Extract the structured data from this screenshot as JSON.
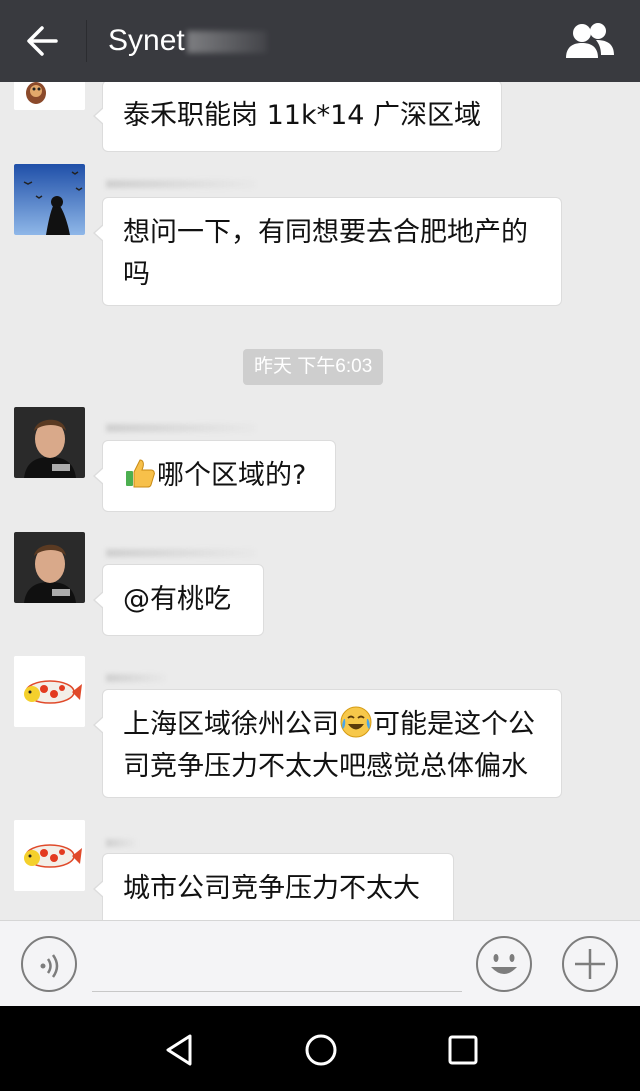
{
  "header": {
    "title": "Synet",
    "back_icon": "arrow-left-icon",
    "group_icon": "group-people-icon"
  },
  "messages": [
    {
      "text": "泰禾职能岗 11k*14 广深区域",
      "avatar": "cartoon-avatar"
    },
    {
      "text": "想问一下，有同想要去合肥地产的吗",
      "avatar": "birds-sky-avatar"
    },
    {
      "text": "哪个区域的?",
      "prefix_emoji": "thumbs-up-emoji",
      "avatar": "man-portrait-avatar"
    },
    {
      "text": "@有桃吃",
      "avatar": "man-portrait-avatar"
    },
    {
      "text": "上海区域徐州公司",
      "emoji": "crying-laughing-emoji",
      "text_after": "可能是这个公司竞争压力不太大吧感觉总体偏水",
      "avatar": "koi-fish-avatar"
    },
    {
      "text": "城市公司竞争压力不太大",
      "avatar": "koi-fish-avatar"
    }
  ],
  "timestamp": "昨天 下午6:03",
  "input_bar": {
    "voice_icon": "voice-icon",
    "emoji_icon": "smiley-icon",
    "plus_icon": "plus-icon"
  },
  "nav": {
    "back": "triangle-back-icon",
    "home": "circle-home-icon",
    "recents": "square-recents-icon"
  },
  "colors": {
    "header_bg": "#393a3f",
    "chat_bg": "#ebebeb",
    "bubble_bg": "#ffffff"
  }
}
